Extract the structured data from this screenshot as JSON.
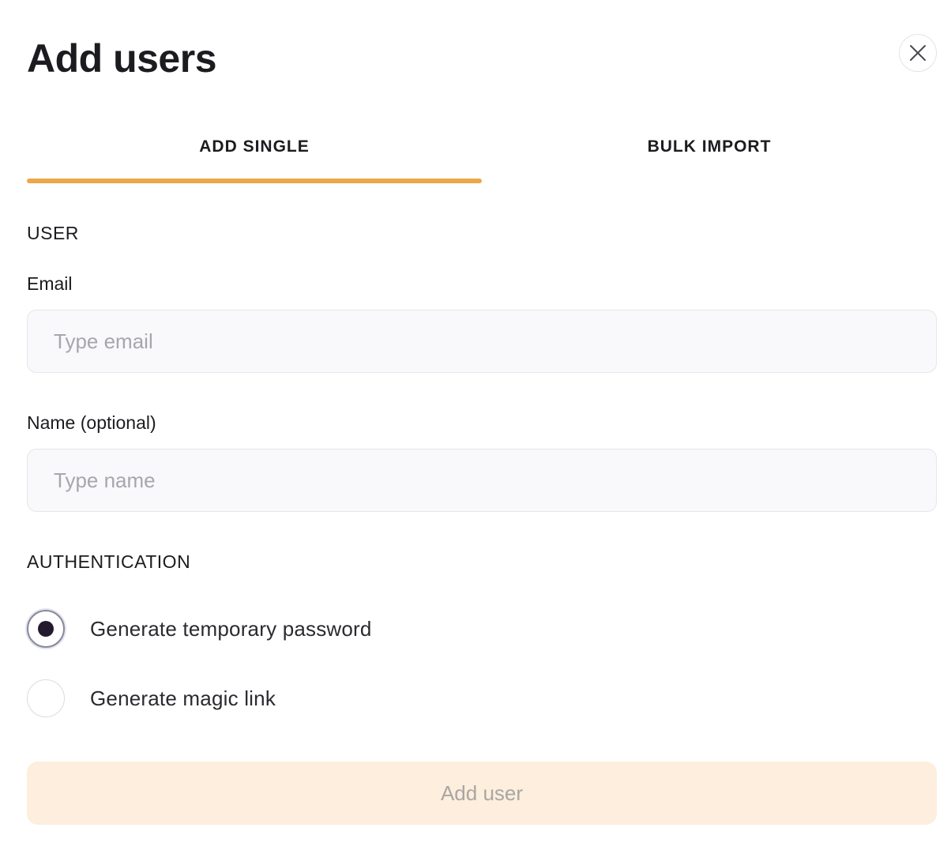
{
  "dialog": {
    "title": "Add users",
    "close_icon": "close-icon"
  },
  "tabs": [
    {
      "label": "ADD SINGLE",
      "active": true
    },
    {
      "label": "BULK IMPORT",
      "active": false
    }
  ],
  "colors": {
    "accent": "#eda64a",
    "button_disabled_bg": "#fdeedd",
    "input_bg": "#f9f9fb"
  },
  "user_section": {
    "heading": "USER",
    "email": {
      "label": "Email",
      "placeholder": "Type email",
      "value": ""
    },
    "name": {
      "label": "Name (optional)",
      "placeholder": "Type name",
      "value": ""
    }
  },
  "auth_section": {
    "heading": "AUTHENTICATION",
    "options": [
      {
        "label": "Generate temporary password",
        "selected": true
      },
      {
        "label": "Generate magic link",
        "selected": false
      }
    ]
  },
  "submit": {
    "label": "Add user",
    "disabled": true
  }
}
